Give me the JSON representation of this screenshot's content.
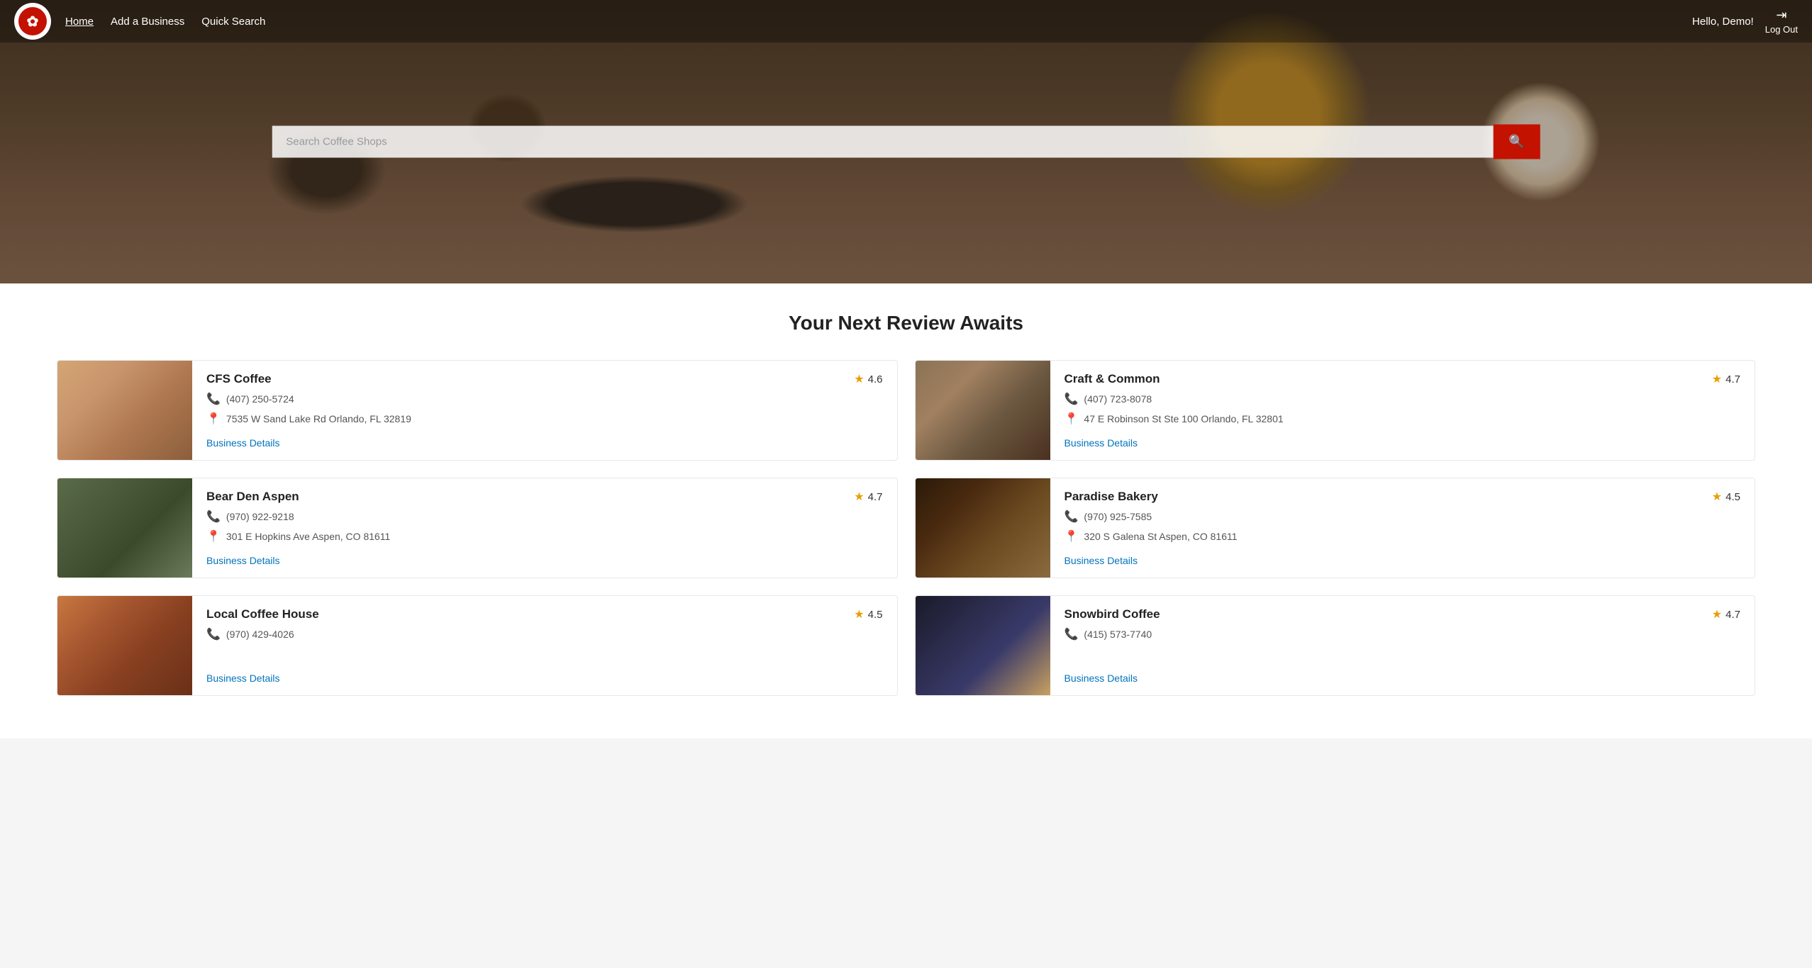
{
  "navbar": {
    "logo_alt": "Yelp-like logo",
    "links": [
      {
        "label": "Home",
        "active": true
      },
      {
        "label": "Add a Business",
        "active": false
      },
      {
        "label": "Quick Search",
        "active": false
      }
    ],
    "greeting": "Hello, Demo!",
    "logout_label": "Log Out"
  },
  "hero": {
    "search_placeholder": "Search Coffee Shops"
  },
  "section": {
    "title": "Your Next Review Awaits"
  },
  "businesses": [
    {
      "id": "cfs-coffee",
      "name": "CFS Coffee",
      "rating": "4.6",
      "phone": "(407) 250-5724",
      "address": "7535 W Sand Lake Rd Orlando, FL 32819",
      "img_class": "img-cfs",
      "details_label": "Business Details"
    },
    {
      "id": "craft-common",
      "name": "Craft & Common",
      "rating": "4.7",
      "phone": "(407) 723-8078",
      "address": "47 E Robinson St Ste 100 Orlando, FL 32801",
      "img_class": "img-craft",
      "details_label": "Business Details"
    },
    {
      "id": "bear-den",
      "name": "Bear Den Aspen",
      "rating": "4.7",
      "phone": "(970) 922-9218",
      "address": "301 E Hopkins Ave Aspen, CO 81611",
      "img_class": "img-bear",
      "details_label": "Business Details"
    },
    {
      "id": "paradise-bakery",
      "name": "Paradise Bakery",
      "rating": "4.5",
      "phone": "(970) 925-7585",
      "address": "320 S Galena St Aspen, CO 81611",
      "img_class": "img-paradise",
      "details_label": "Business Details"
    },
    {
      "id": "local-coffee",
      "name": "Local Coffee House",
      "rating": "4.5",
      "phone": "(970) 429-4026",
      "address": "",
      "img_class": "img-local",
      "details_label": "Business Details"
    },
    {
      "id": "snowbird-coffee",
      "name": "Snowbird Coffee",
      "rating": "4.7",
      "phone": "(415) 573-7740",
      "address": "",
      "img_class": "img-snowbird",
      "details_label": "Business Details"
    }
  ]
}
